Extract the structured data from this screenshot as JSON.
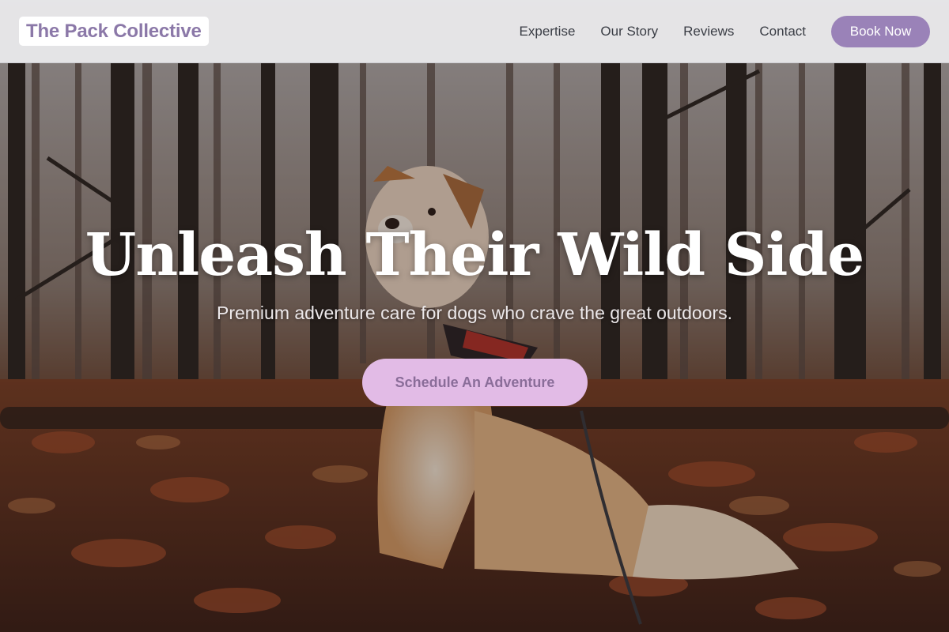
{
  "brand": {
    "name": "The Pack Collective"
  },
  "nav": {
    "links": [
      "Expertise",
      "Our Story",
      "Reviews",
      "Contact"
    ],
    "book_label": "Book Now"
  },
  "hero": {
    "title": "Unleash Their Wild Side",
    "subtitle": "Premium adventure care for dogs who crave the great outdoors.",
    "cta_label": "Schedule An Adventure",
    "image": "dog-in-autumn-forest"
  },
  "colors": {
    "brand": "#8b78a8",
    "button": "#9a82b8",
    "cta_bg": "#e2bbe6",
    "cta_text": "#8a6d99"
  }
}
